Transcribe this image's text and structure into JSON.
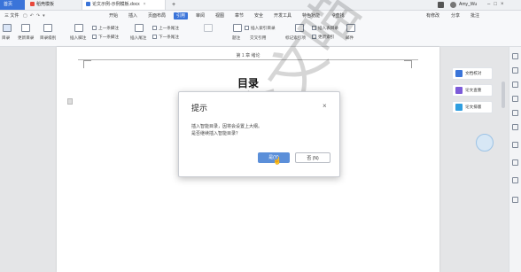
{
  "window": {
    "tabs": [
      {
        "label": "首页",
        "active": false
      },
      {
        "label": "稻壳模板",
        "active": false
      },
      {
        "label": "论文示例-示例模板.docx",
        "active": true
      }
    ],
    "new_tab": "+",
    "user_name": "Amy_Wu"
  },
  "menu": {
    "file": "三 文件",
    "tabs": [
      "开始",
      "插入",
      "页面布局",
      "引用",
      "审阅",
      "视图",
      "章节",
      "安全",
      "开发工具",
      "特色功能"
    ],
    "active_tab": "引用",
    "search": "查找",
    "right": [
      "有修改",
      "分享",
      "批注"
    ]
  },
  "toolbar": {
    "big": [
      "目录",
      "更新目录",
      "目录级别",
      "插入脚注",
      "插入尾注",
      "题注",
      "交叉引用",
      "标记索引项",
      "邮件"
    ],
    "small": [
      "上一条脚注",
      "下一条脚注",
      "上一条尾注",
      "下一条尾注",
      "插入索引目录",
      "插入表目录",
      "更新索引"
    ]
  },
  "document": {
    "header_text": "第 1 章  绪论",
    "title": "目录",
    "watermark": "论文喵"
  },
  "dialog": {
    "title": "提示",
    "close": "×",
    "message_line1": "插入智能目录，因将会设置上大纲。",
    "message_line2": "是否继续插入智能目录？",
    "ok_label": "是(Y)",
    "cancel_label": "否 (N)"
  },
  "side_panel": {
    "items": [
      "文档校对",
      "论文查重",
      "论文排版"
    ]
  },
  "colors": {
    "accent": "#3a74d9",
    "tab_active_bg": "#ffffff",
    "dialog_ok": "#5b8fd9"
  }
}
